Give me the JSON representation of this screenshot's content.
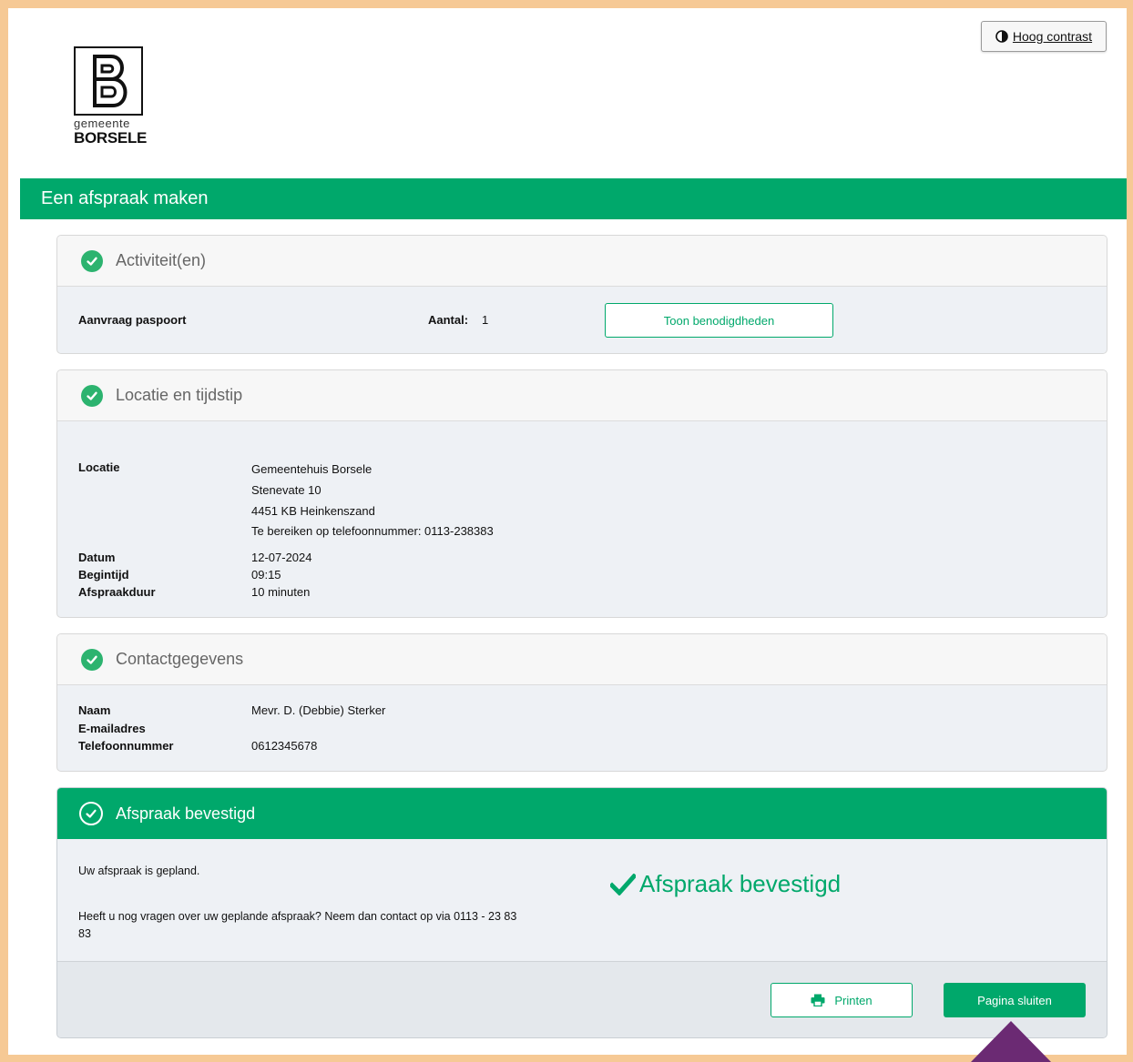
{
  "header": {
    "high_contrast_label": "Hoog contrast",
    "logo_sub": "gemeente",
    "logo_name": "BORSELE",
    "page_title": "Een afspraak maken"
  },
  "activities": {
    "title": "Activiteit(en)",
    "activity_name": "Aanvraag paspoort",
    "count_label": "Aantal:",
    "count_value": "1",
    "show_requirements_label": "Toon benodigdheden"
  },
  "location": {
    "title": "Locatie en tijdstip",
    "location_label": "Locatie",
    "address_lines": [
      "Gemeentehuis Borsele",
      "Stenevate 10",
      "4451 KB Heinkenszand",
      "Te bereiken op telefoonnummer: 0113-238383"
    ],
    "date_label": "Datum",
    "date_value": "12-07-2024",
    "start_label": "Begintijd",
    "start_value": "09:15",
    "duration_label": "Afspraakduur",
    "duration_value": "10 minuten"
  },
  "contact": {
    "title": "Contactgegevens",
    "name_label": "Naam",
    "name_value": "Mevr. D. (Debbie) Sterker",
    "email_label": "E-mailadres",
    "email_value": "",
    "phone_label": "Telefoonnummer",
    "phone_value": "0612345678"
  },
  "confirmation": {
    "title": "Afspraak bevestigd",
    "planned_text": "Uw afspraak is gepland.",
    "questions_text_line1": "Heeft u nog vragen over uw geplande afspraak? Neem dan contact op via 0113 - 23 83",
    "questions_text_line2": "83",
    "confirmed_badge": "Afspraak bevestigd",
    "print_label": "Printen",
    "close_label": "Pagina sluiten"
  },
  "colors": {
    "brand_green": "#00a86b",
    "page_border": "#f6c995",
    "annotation_arrow": "#6b2a73"
  },
  "icons": {
    "high_contrast": "contrast-half-circle-icon",
    "section_check": "check-circle-icon",
    "print": "printer-icon",
    "confirmed": "checkmark-icon"
  }
}
